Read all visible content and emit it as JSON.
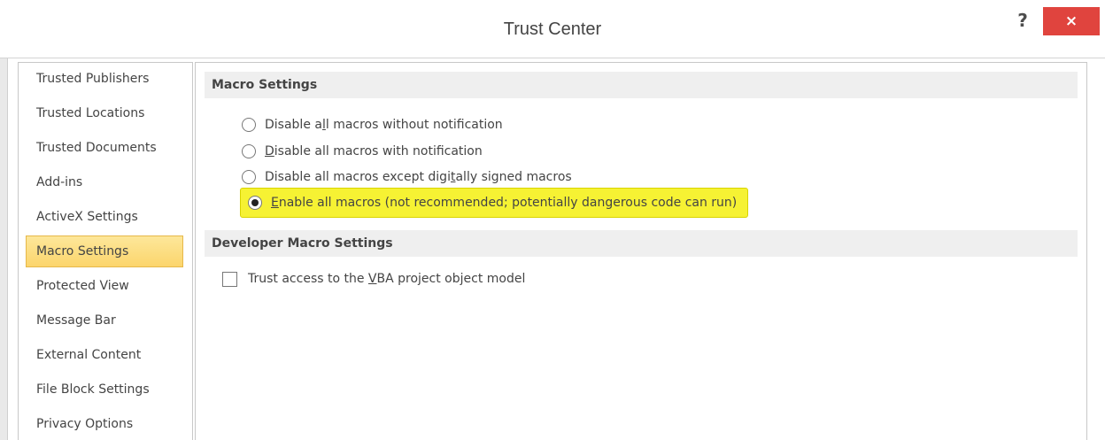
{
  "window": {
    "title": "Trust Center",
    "help_label": "?",
    "close_label": "×"
  },
  "sidebar": {
    "items": [
      {
        "label": "Trusted Publishers"
      },
      {
        "label": "Trusted Locations"
      },
      {
        "label": "Trusted Documents"
      },
      {
        "label": "Add-ins"
      },
      {
        "label": "ActiveX Settings"
      },
      {
        "label": "Macro Settings",
        "selected": true
      },
      {
        "label": "Protected View"
      },
      {
        "label": "Message Bar"
      },
      {
        "label": "External Content"
      },
      {
        "label": "File Block Settings"
      },
      {
        "label": "Privacy Options"
      }
    ]
  },
  "macro_settings": {
    "header": "Macro Settings",
    "options": [
      {
        "pre": "Disable a",
        "ul": "l",
        "post": "l macros without notification",
        "checked": false
      },
      {
        "pre": "",
        "ul": "D",
        "post": "isable all macros with notification",
        "checked": false
      },
      {
        "pre": "Disable all macros except digi",
        "ul": "t",
        "post": "ally signed macros",
        "checked": false
      },
      {
        "pre": "",
        "ul": "E",
        "post": "nable all macros (not recommended; potentially dangerous code can run)",
        "checked": true
      }
    ]
  },
  "developer_settings": {
    "header": "Developer Macro Settings",
    "trust_vba": {
      "pre": "Trust access to the ",
      "ul": "V",
      "post": "BA project object model",
      "checked": false
    }
  },
  "colors": {
    "highlight": "#f6f233",
    "selected_nav": "#fcd56c",
    "close_button": "#e0443e"
  }
}
